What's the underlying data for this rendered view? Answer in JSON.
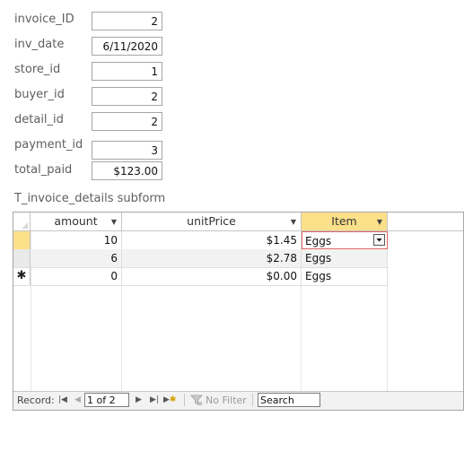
{
  "form": {
    "fields": [
      {
        "label": "invoice_ID",
        "value": "2"
      },
      {
        "label": "inv_date",
        "value": "6/11/2020"
      },
      {
        "label": "store_id",
        "value": "1"
      },
      {
        "label": "buyer_id",
        "value": "2"
      },
      {
        "label": "detail_id",
        "value": "2"
      },
      {
        "label": "payment_id",
        "value": "3"
      },
      {
        "label": "total_paid",
        "value": "$123.00"
      }
    ]
  },
  "subform": {
    "caption": "T_invoice_details subform",
    "columns": [
      "amount",
      "unitPrice",
      "Item"
    ],
    "rows": [
      {
        "amount": "10",
        "unitPrice": "$1.45",
        "item": "Eggs"
      },
      {
        "amount": "6",
        "unitPrice": "$2.78",
        "item": "Eggs"
      },
      {
        "amount": "0",
        "unitPrice": "$0.00",
        "item": "Eggs"
      }
    ],
    "new_record_marker": "✱"
  },
  "navigation": {
    "record_label": "Record:",
    "record_position": "1 of 2",
    "filter_label": "No Filter",
    "search_value": "Search"
  },
  "colors": {
    "selected_header": "#fde08a",
    "current_row_selector": "#fde08a",
    "active_cell_border": "#e06464"
  }
}
